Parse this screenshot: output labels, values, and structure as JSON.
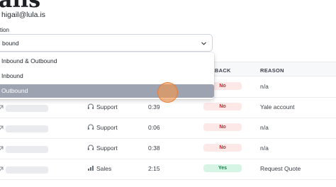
{
  "header": {
    "title": "alls",
    "user_email": "higail@lula.is"
  },
  "filter": {
    "label": "tion",
    "selected_value": "bound",
    "chevron_icon": "chevron-down-icon",
    "options": [
      {
        "label": "Inbound & Outbound",
        "selected": false
      },
      {
        "label": "Inbound",
        "selected": false
      },
      {
        "label": "Outbound",
        "selected": true
      }
    ]
  },
  "table": {
    "columns": [
      {
        "label": "LBACK"
      },
      {
        "label": "REASON"
      }
    ],
    "rows": [
      {
        "team": "",
        "duration": "",
        "callback": "No",
        "reason": "n/a"
      },
      {
        "team": "Support",
        "duration": "0:39",
        "callback": "No",
        "reason": "Yale account"
      },
      {
        "team": "Support",
        "duration": "0:06",
        "callback": "No",
        "reason": "n/a"
      },
      {
        "team": "Support",
        "duration": "0:38",
        "callback": "No",
        "reason": "n/a"
      },
      {
        "team": "Sales",
        "duration": "2:15",
        "callback": "Yes",
        "reason": "Request Quote"
      }
    ]
  },
  "colors": {
    "badge_no_bg": "#fde8e8",
    "badge_no_text": "#c62828",
    "badge_yes_bg": "#d7f5e4",
    "badge_yes_text": "#13804a",
    "option_selected_bg": "#9ea3b1",
    "cursor_ring": "#f0964f"
  }
}
